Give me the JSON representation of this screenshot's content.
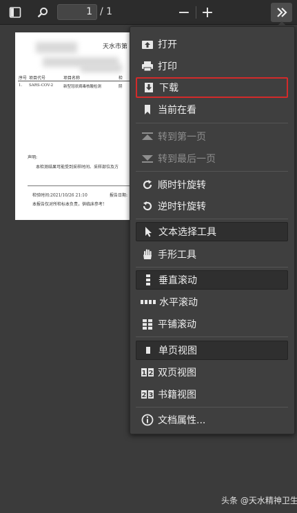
{
  "toolbar": {
    "page_current": "1",
    "page_total": "/ 1",
    "zoom_out": "−",
    "zoom_in": "+"
  },
  "document": {
    "header_right": "天水市第",
    "col_headers": [
      "序号",
      "项目代号",
      "项目名称",
      "检"
    ],
    "row1": [
      "1.",
      "SARS-COV-2",
      "新型冠状病毒核酸检测",
      "阴"
    ],
    "remark_label": "声明:",
    "remark_text": "本检测结果可能受到采样时间、采样部位及方",
    "footer_time": "检验时间:2021/10/26  21:10",
    "footer_report": "报告日期:",
    "footer_note": "本报告仅对所检标本负责，供临床参考!"
  },
  "menu": {
    "items": [
      {
        "label": "打开",
        "icon": "open-icon"
      },
      {
        "label": "打印",
        "icon": "print-icon"
      },
      {
        "label": "下载",
        "icon": "download-icon"
      },
      {
        "label": "当前在看",
        "icon": "bookmark-icon"
      },
      {
        "label": "转到第一页",
        "icon": "first-page-icon"
      },
      {
        "label": "转到最后一页",
        "icon": "last-page-icon"
      },
      {
        "label": "顺时针旋转",
        "icon": "rotate-cw-icon"
      },
      {
        "label": "逆时针旋转",
        "icon": "rotate-ccw-icon"
      },
      {
        "label": "文本选择工具",
        "icon": "cursor-icon"
      },
      {
        "label": "手形工具",
        "icon": "hand-icon"
      },
      {
        "label": "垂直滚动",
        "icon": "vertical-scroll-icon"
      },
      {
        "label": "水平滚动",
        "icon": "horizontal-scroll-icon"
      },
      {
        "label": "平铺滚动",
        "icon": "wrapped-scroll-icon"
      },
      {
        "label": "单页视图",
        "icon": "single-page-icon"
      },
      {
        "label": "双页视图",
        "icon": "two-page-icon"
      },
      {
        "label": "书籍视图",
        "icon": "book-view-icon"
      },
      {
        "label": "文档属性...",
        "icon": "info-icon"
      }
    ]
  },
  "watermark": "头条 @天水精神卫生"
}
